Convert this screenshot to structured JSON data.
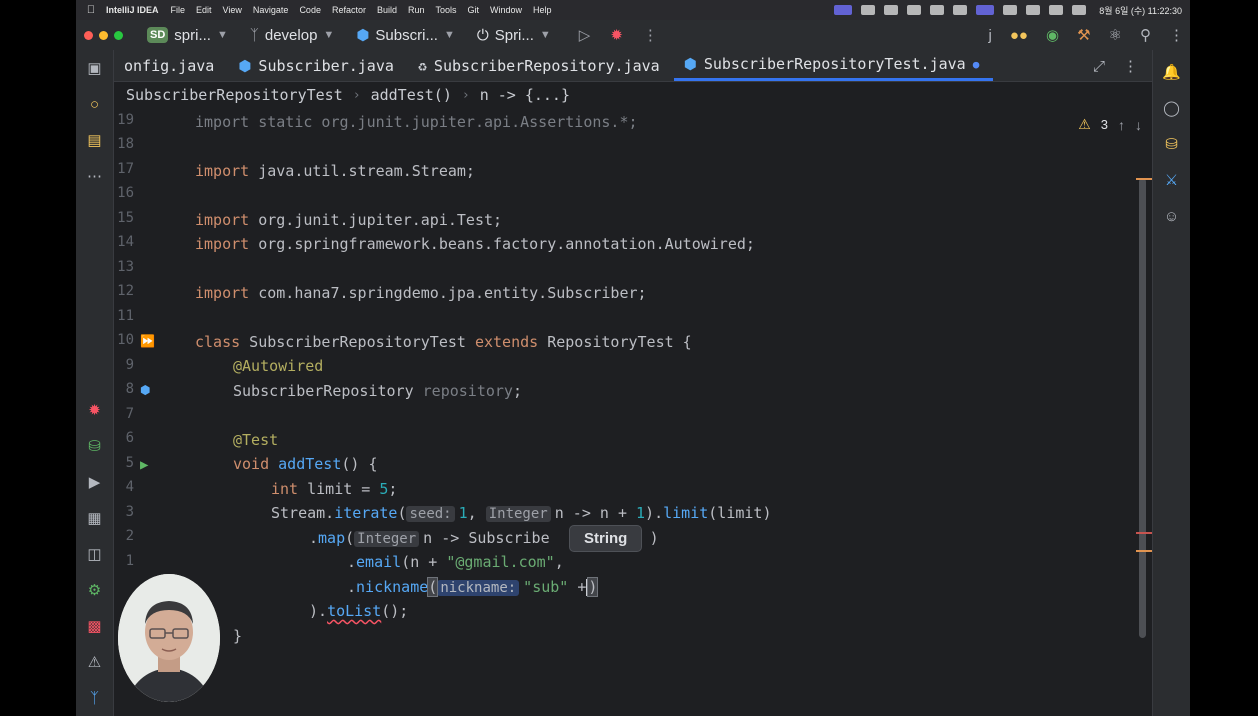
{
  "menubar": {
    "app_name": "IntelliJ IDEA",
    "items": [
      "File",
      "Edit",
      "View",
      "Navigate",
      "Code",
      "Refactor",
      "Build",
      "Run",
      "Tools",
      "Git",
      "Window",
      "Help"
    ],
    "clock": "8월 6일 (수) 11:22:30"
  },
  "toolbar": {
    "project_badge": "SD",
    "project_name": "spri...",
    "branch": "develop",
    "module": "Subscri...",
    "run_config": "Spri..."
  },
  "tabs": [
    {
      "label": "onfig.java",
      "icon": "java-icon",
      "active": false
    },
    {
      "label": "Subscriber.java",
      "icon": "class-icon",
      "active": false
    },
    {
      "label": "SubscriberRepository.java",
      "icon": "repository-icon",
      "active": false
    },
    {
      "label": "SubscriberRepositoryTest.java",
      "icon": "test-class-icon",
      "active": true,
      "modified": true
    }
  ],
  "breadcrumb": [
    "SubscriberRepositoryTest",
    "addTest()",
    "n -> {...}"
  ],
  "inspections": {
    "warnings": "3"
  },
  "editor": {
    "line_numbers": [
      "19",
      "18",
      "17",
      "16",
      "15",
      "14",
      "13",
      "12",
      "11",
      "10",
      "9",
      "8",
      "7",
      "6",
      "5",
      "4",
      "3",
      "2",
      "1",
      "",
      ""
    ],
    "code": {
      "l19": "import static org.junit.jupiter.api.Assertions.*;",
      "l17_kw": "import",
      "l17_rest": " java.util.stream.Stream;",
      "l15_kw": "import",
      "l15_rest": " org.junit.jupiter.api.Test;",
      "l14_kw": "import",
      "l14_rest": " org.springframework.beans.factory.annotation.Autowired;",
      "l12_kw": "import",
      "l12_rest": " com.hana7.springdemo.jpa.entity.Subscriber;",
      "l10_class": "class",
      "l10_name": " SubscriberRepositoryTest ",
      "l10_extends": "extends",
      "l10_rest": " RepositoryTest {",
      "l9": "@Autowired",
      "l8_type": "SubscriberRepository ",
      "l8_field": "repository",
      "l8_end": ";",
      "l6": "@Test",
      "l5_void": "void",
      "l5_name": " addTest",
      "l5_rest": "() {",
      "l4_int": "int",
      "l4_rest": " limit = ",
      "l4_num": "5",
      "l4_end": ";",
      "l3_a": "Stream.",
      "l3_iter": "iterate",
      "l3_b": "(",
      "l3_hint_seed": "seed:",
      "l3_num1": "1",
      "l3_c": ", ",
      "l3_hint_int": "Integer",
      "l3_d": "n -> n + ",
      "l3_num2": "1",
      "l3_e": ").",
      "l3_limit": "limit",
      "l3_f": "(limit)",
      "l2_a": ".",
      "l2_map": "map",
      "l2_b": "(",
      "l2_hint_int": "Integer",
      "l2_c": "n -> Subscribe",
      "l2_end": ")",
      "l1_a": ".",
      "l1_email": "email",
      "l1_b": "(n + ",
      "l1_str": "\"@gmail.com\"",
      "l1_c": ",",
      "l0_a": ".",
      "l0_nick": "nickname",
      "l0_b": "(",
      "l0_hint": "nickname:",
      "l0_str": "\"sub\"",
      "l0_c": " +",
      "l0_d": ")",
      "lm1_a": ").",
      "lm1_tolist": "toList",
      "lm1_b": "();",
      "lm2": "}"
    },
    "tooltip": "String"
  },
  "colors": {
    "background": "#1e1f22",
    "panel": "#2b2d30",
    "accent": "#3574f0",
    "keyword": "#cf8e6d",
    "method": "#56a8f5",
    "string": "#6aab73",
    "number": "#2aacb8"
  }
}
